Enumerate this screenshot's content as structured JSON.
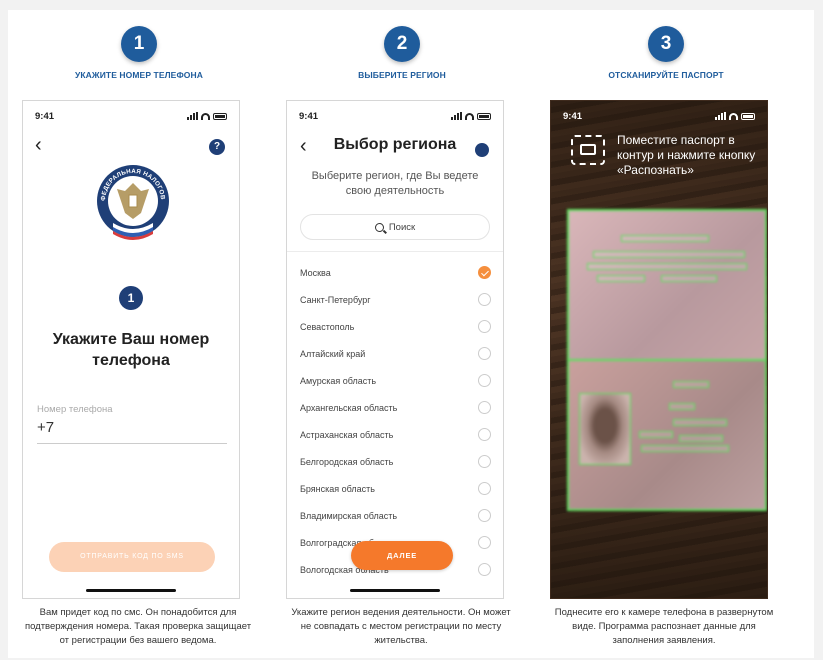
{
  "steps": [
    {
      "number": "1",
      "title": "УКАЖИТЕ НОМЕР ТЕЛЕФОНА"
    },
    {
      "number": "2",
      "title": "ВЫБЕРИТЕ РЕГИОН"
    },
    {
      "number": "3",
      "title": "ОТСКАНИРУЙТЕ ПАСПОРТ"
    }
  ],
  "status_time": "9:41",
  "screen1": {
    "back_icon": "‹",
    "help_icon": "?",
    "emblem_text": "ФЕДЕРАЛЬНАЯ НАЛОГОВАЯ СЛУЖБА",
    "badge": "1",
    "heading": "Укажите Ваш номер телефона",
    "phone_label": "Номер телефона",
    "phone_value": "+7",
    "send_button": "ОТПРАВИТЬ КОД ПО SMS"
  },
  "screen2": {
    "back_icon": "‹",
    "title": "Выбор региона",
    "subtitle": "Выберите регион, где Вы ведете свою деятельность",
    "search_placeholder": "Поиск",
    "regions": [
      {
        "name": "Москва",
        "selected": true
      },
      {
        "name": "Санкт-Петербург",
        "selected": false
      },
      {
        "name": "Севастополь",
        "selected": false
      },
      {
        "name": "Алтайский край",
        "selected": false
      },
      {
        "name": "Амурская область",
        "selected": false
      },
      {
        "name": "Архангельская область",
        "selected": false
      },
      {
        "name": "Астраханская область",
        "selected": false
      },
      {
        "name": "Белгородская область",
        "selected": false
      },
      {
        "name": "Брянская область",
        "selected": false
      },
      {
        "name": "Владимирская область",
        "selected": false
      },
      {
        "name": "Волгоградская область",
        "selected": false
      },
      {
        "name": "Вологодская область",
        "selected": false
      }
    ],
    "next_button": "ДАЛЕЕ"
  },
  "screen3": {
    "instruction": "Поместите паспорт в контур и нажмите кнопку «Распознать»"
  },
  "captions": [
    "Вам придет код по смс. Он понадобится для подтверждения номера. Такая проверка защищает от регистрации без вашего ведома.",
    "Укажите регион ведения деятельности. Он может не совпадать с местом регистрации по месту жительства.",
    "Поднесите его к камере телефона в развернутом виде. Программа распознает данные для заполнения заявления."
  ],
  "colors": {
    "primary": "#1f5c9c",
    "accent": "#f5792b",
    "frame": "#5de05d"
  }
}
